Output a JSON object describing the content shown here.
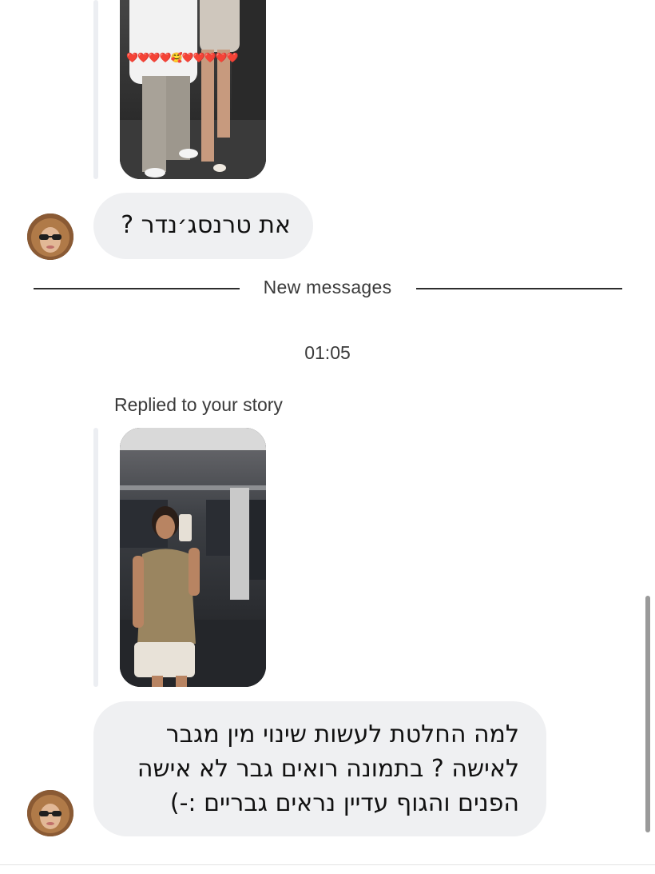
{
  "conversation": {
    "messages": [
      {
        "type": "story_reply",
        "story_thumbnail": "story-photo-couple",
        "emoji_overlay": "❤️❤️❤️❤️🥰❤️❤️❤️❤️❤️",
        "text": "את טרנסג׳נדר ?",
        "sender_avatar": "avatar-woman-sunglasses"
      }
    ],
    "new_messages_divider": "New messages",
    "timestamp": "01:05",
    "replied_label": "Replied to your story",
    "second_reply": {
      "story_thumbnail": "story-photo-mirror-selfie",
      "text_lines": [
        "למה החלטת לעשות שינוי מין מגבר",
        "לאישה ? בתמונה רואים גבר לא אישה",
        "הפנים והגוף עדיין נראים גבריים :-)"
      ],
      "sender_avatar": "avatar-woman-sunglasses"
    }
  },
  "colors": {
    "bubble_background": "#eff0f2",
    "thread_line": "#eceef2",
    "divider": "#2d2d2d",
    "secondary_text": "#3a3a3a",
    "scrollbar": "#9a9a9a"
  }
}
